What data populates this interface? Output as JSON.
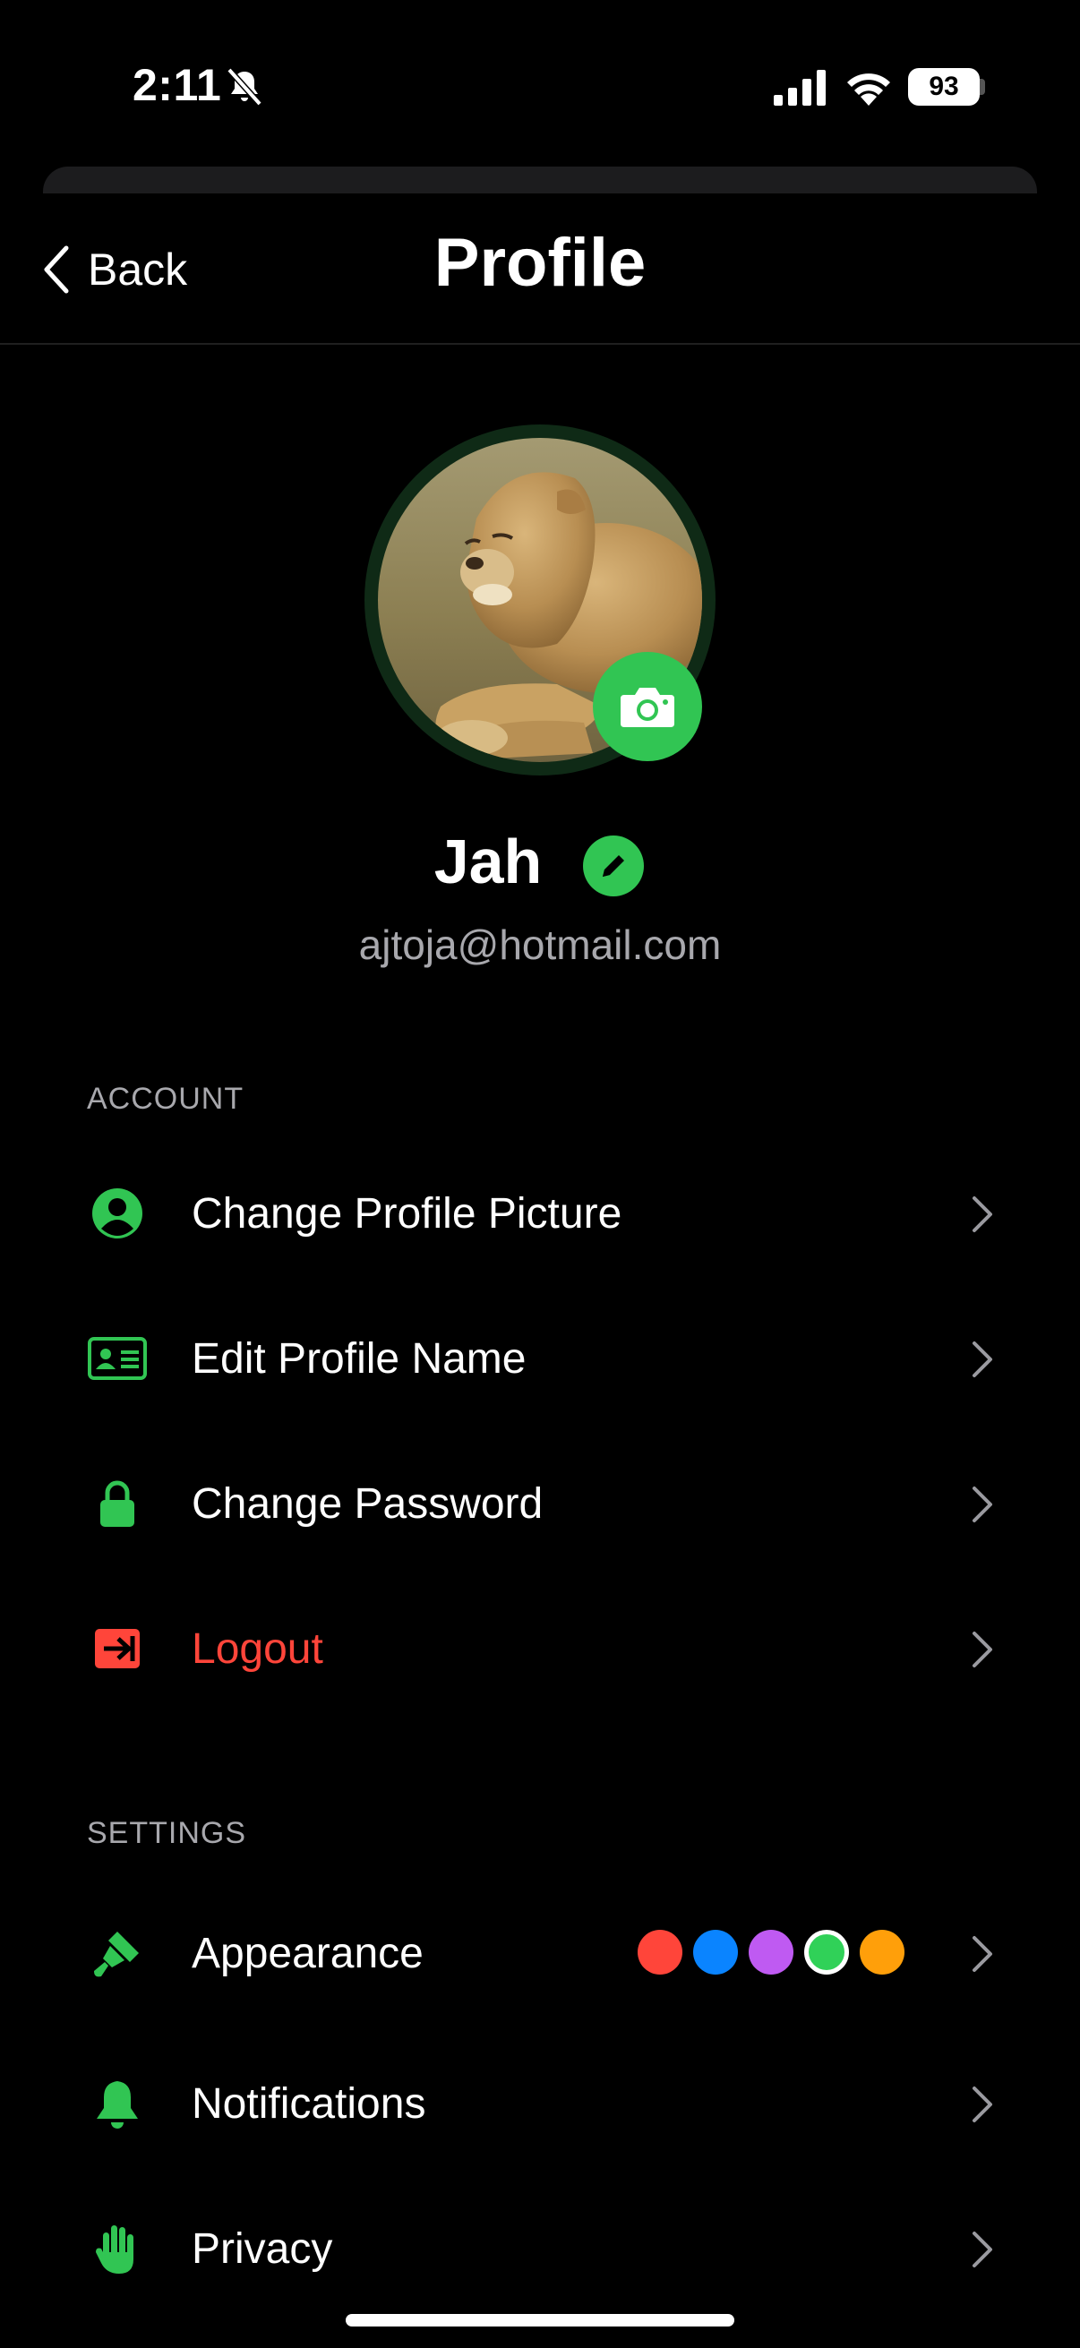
{
  "status_bar": {
    "time": "2:11",
    "battery": "93"
  },
  "nav": {
    "back_label": "Back",
    "title": "Profile"
  },
  "profile": {
    "name": "Jah",
    "email": "ajtoja@hotmail.com",
    "avatar_subject": "lioness photo"
  },
  "account": {
    "header": "ACCOUNT",
    "items": [
      {
        "label": "Change Profile Picture",
        "icon": "person-circle-icon"
      },
      {
        "label": "Edit Profile Name",
        "icon": "id-card-icon"
      },
      {
        "label": "Change Password",
        "icon": "lock-icon"
      },
      {
        "label": "Logout",
        "icon": "logout-icon"
      }
    ]
  },
  "settings": {
    "header": "SETTINGS",
    "items": [
      {
        "label": "Appearance",
        "icon": "paintbrush-icon"
      },
      {
        "label": "Notifications",
        "icon": "bell-icon"
      },
      {
        "label": "Privacy",
        "icon": "hand-icon"
      }
    ],
    "appearance_colors": [
      "#ff453a",
      "#0a84ff",
      "#bf5af2",
      "#30d158",
      "#ff9f0a"
    ],
    "selected_color": "#30d158"
  },
  "colors": {
    "accent": "#31c553",
    "danger": "#ff453a",
    "secondary_text": "#a8a8ad"
  }
}
